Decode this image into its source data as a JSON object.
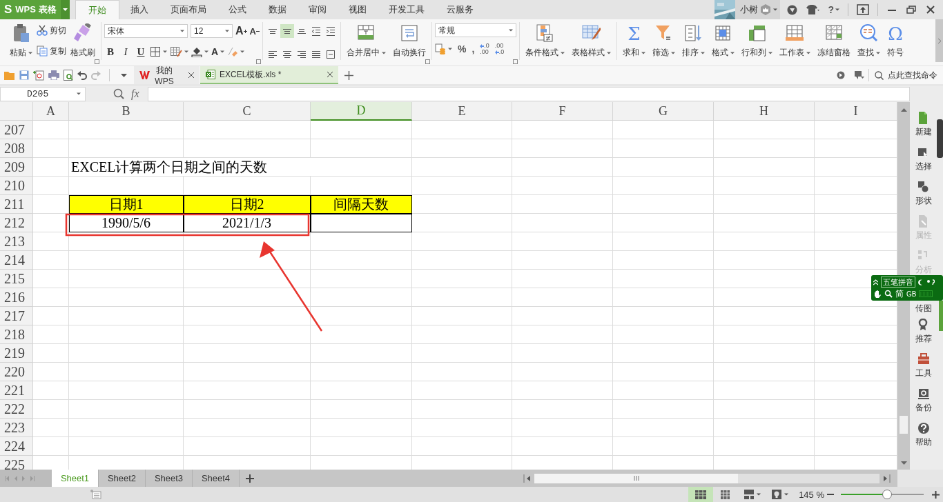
{
  "title_bar": {
    "logo_letter": "S",
    "app_name": "WPS 表格",
    "tabs": [
      {
        "label": "开始",
        "selected": true
      },
      {
        "label": "插入",
        "selected": false
      },
      {
        "label": "页面布局",
        "selected": false
      },
      {
        "label": "公式",
        "selected": false
      },
      {
        "label": "数据",
        "selected": false
      },
      {
        "label": "审阅",
        "selected": false
      },
      {
        "label": "视图",
        "selected": false
      },
      {
        "label": "开发工具",
        "selected": false
      },
      {
        "label": "云服务",
        "selected": false
      }
    ],
    "user_name": "小树",
    "help": "?"
  },
  "ribbon": {
    "clipboard": {
      "paste": "粘贴",
      "cut": "剪切",
      "copy": "复制",
      "format_painter": "格式刷"
    },
    "font": {
      "font_name": "宋体",
      "font_size": "12",
      "grow": "A",
      "shrink": "A",
      "bold": "B",
      "italic": "I",
      "underline": "U",
      "font_color": "A"
    },
    "alignment_buttons": [
      {
        "kind": "top",
        "selected": false
      },
      {
        "kind": "middle",
        "selected": true
      },
      {
        "kind": "bottom",
        "selected": false
      },
      {
        "kind": "outdent",
        "selected": false
      },
      {
        "kind": "indent",
        "selected": false
      },
      {
        "kind": "left",
        "selected": false
      },
      {
        "kind": "center",
        "selected": false
      },
      {
        "kind": "right",
        "selected": false
      },
      {
        "kind": "justify",
        "selected": false
      },
      {
        "kind": "distributed",
        "selected": false
      }
    ],
    "alignment_large": [
      {
        "label": "合并居中",
        "kind": "merge",
        "dropdown": true
      },
      {
        "label": "自动换行",
        "kind": "wrap",
        "dropdown": false
      }
    ],
    "number": {
      "format": "常规",
      "percent": "%",
      "comma": ",",
      "increase_decimal": {
        "top": ".0",
        "bottom": ".00"
      },
      "decrease_decimal": {
        "top": ".00",
        "bottom": ".0"
      }
    },
    "styles": [
      {
        "label": "条件格式",
        "kind": "conditional",
        "dropdown": true
      },
      {
        "label": "表格样式",
        "kind": "table_style",
        "dropdown": true
      }
    ],
    "editing": [
      {
        "label": "求和",
        "kind": "sum",
        "glyph": "Σ",
        "dropdown": true
      },
      {
        "label": "筛选",
        "kind": "filter",
        "dropdown": true
      },
      {
        "label": "排序",
        "kind": "sort",
        "dropdown": true
      },
      {
        "label": "格式",
        "kind": "format",
        "dropdown": true
      },
      {
        "label": "行和列",
        "kind": "rowcol",
        "dropdown": true
      },
      {
        "label": "工作表",
        "kind": "sheet",
        "dropdown": true
      },
      {
        "label": "冻结窗格",
        "kind": "freeze",
        "dropdown": false
      },
      {
        "label": "查找",
        "kind": "find",
        "dropdown": true
      },
      {
        "label": "符号",
        "kind": "symbol",
        "glyph": "Ω",
        "dropdown": false
      }
    ]
  },
  "document_bar": {
    "tabs": [
      {
        "label": "我的WPS",
        "kind": "home",
        "selected": false
      },
      {
        "label": "EXCEL模板.xls *",
        "kind": "workbook",
        "selected": true
      }
    ],
    "command_search": {
      "placeholder": "点此查找命令"
    }
  },
  "formula_bar": {
    "name_box": "D205",
    "fx": "fx"
  },
  "sheet": {
    "columns": [
      {
        "label": "A",
        "selected": false
      },
      {
        "label": "B",
        "selected": false
      },
      {
        "label": "C",
        "selected": false
      },
      {
        "label": "D",
        "selected": true
      },
      {
        "label": "E",
        "selected": false
      },
      {
        "label": "F",
        "selected": false
      },
      {
        "label": "G",
        "selected": false
      },
      {
        "label": "H",
        "selected": false
      },
      {
        "label": "I",
        "selected": false
      }
    ],
    "rows": [
      {
        "number": "207"
      },
      {
        "number": "208"
      },
      {
        "number": "209",
        "cells": [
          {},
          {
            "kind": "title",
            "text": "EXCEL计算两个日期之间的天数"
          }
        ]
      },
      {
        "number": "210"
      },
      {
        "number": "211",
        "cells": [
          {},
          {
            "kind": "header",
            "text": "日期1"
          },
          {
            "kind": "header",
            "text": "日期2"
          },
          {
            "kind": "header",
            "text": "间隔天数"
          }
        ]
      },
      {
        "number": "212",
        "cells": [
          {},
          {
            "kind": "value",
            "text": "1990/5/6"
          },
          {
            "kind": "value",
            "text": "2021/1/3"
          },
          {
            "kind": "value"
          }
        ]
      },
      {
        "number": "213"
      },
      {
        "number": "214"
      },
      {
        "number": "215"
      },
      {
        "number": "216"
      },
      {
        "number": "217"
      },
      {
        "number": "218"
      },
      {
        "number": "219"
      },
      {
        "number": "220"
      },
      {
        "number": "221"
      },
      {
        "number": "222"
      },
      {
        "number": "223"
      },
      {
        "number": "224"
      },
      {
        "number": "225"
      }
    ],
    "highlight_box": true,
    "pointer_arrow": true
  },
  "sidebar": {
    "items": [
      {
        "label": "新建",
        "kind": "new",
        "disabled": false
      },
      {
        "label": "选择",
        "kind": "select",
        "disabled": false
      },
      {
        "label": "形状",
        "kind": "shape",
        "disabled": false
      },
      {
        "label": "属性",
        "kind": "property",
        "disabled": true
      },
      {
        "label": "分析",
        "kind": "analyze",
        "disabled": true
      },
      {
        "label": "传图",
        "kind": "upload",
        "disabled": false
      },
      {
        "label": "推荐",
        "kind": "recommend",
        "disabled": false
      },
      {
        "label": "工具",
        "kind": "tools",
        "disabled": false
      },
      {
        "label": "备份",
        "kind": "backup",
        "disabled": false
      },
      {
        "label": "帮助",
        "kind": "help",
        "disabled": false
      }
    ]
  },
  "ime": {
    "mode": "五笔拼音",
    "script": "简",
    "charset": "GB"
  },
  "sheet_tabs": [
    {
      "label": "Sheet1",
      "selected": true
    },
    {
      "label": "Sheet2",
      "selected": false
    },
    {
      "label": "Sheet3",
      "selected": false
    },
    {
      "label": "Sheet4",
      "selected": false
    }
  ],
  "status_bar": {
    "views": [
      {
        "kind": "normal",
        "selected": true
      },
      {
        "kind": "page_break",
        "selected": false
      }
    ],
    "zoom": "145 %",
    "zoom_slider": {
      "level": 0.57
    }
  }
}
